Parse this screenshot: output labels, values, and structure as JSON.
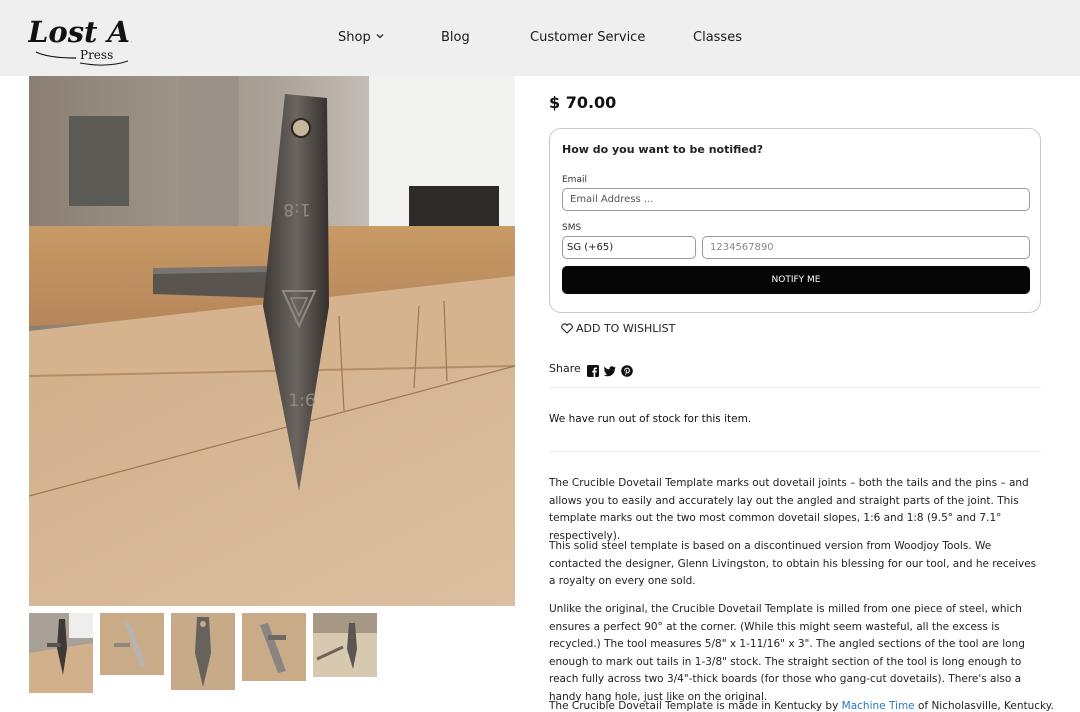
{
  "header": {
    "logo": {
      "line1": "Lost Art",
      "line2": "Press"
    },
    "nav": [
      {
        "label": "Shop",
        "has_dropdown": true
      },
      {
        "label": "Blog",
        "has_dropdown": false
      },
      {
        "label": "Customer Service",
        "has_dropdown": false
      },
      {
        "label": "Classes",
        "has_dropdown": false
      }
    ],
    "background": "#efefef"
  },
  "product": {
    "price": "$ 70.00",
    "main_image": {
      "markings": [
        "1:8",
        "1:6"
      ]
    },
    "thumbnail_count": 5
  },
  "notify": {
    "title": "How do you want to be notified?",
    "email_label": "Email",
    "email_placeholder": "Email Address ...",
    "sms_label": "SMS",
    "sms_country": "SG (+65)",
    "phone_placeholder": "1234567890",
    "button_label": "NOTIFY ME",
    "button_color": "#060606"
  },
  "wishlist": {
    "label": "ADD TO WISHLIST",
    "icon": "heart-icon"
  },
  "share": {
    "label": "Share",
    "icons": [
      "facebook-icon",
      "twitter-icon",
      "pinterest-icon"
    ]
  },
  "stock_message": "We have run out of stock for this item.",
  "description": {
    "p1": "The Crucible Dovetail Template marks out dovetail joints – both the tails and the pins – and allows you to easily and accurately lay out the angled and straight parts of the joint. This template marks out the two most common dovetail slopes, 1:6 and 1:8 (9.5° and 7.1° respectively).",
    "p2": "This solid steel template is based on a discontinued version from Woodjoy Tools. We contacted the designer, Glenn Livingston, to obtain his blessing for our tool, and he receives a royalty on every one sold.",
    "p3": "Unlike the original, the Crucible Dovetail Template is milled from one piece of steel, which ensures a perfect 90° at the corner. (While this might seem wasteful, all the excess is recycled.) The tool measures 5/8\" x 1-11/16\" x 3\". The angled sections of the tool are long enough to mark out tails in 1-3/8\" stock. The straight section of the tool is long enough to reach fully across two 3/4\"-thick boards (for those who gang-cut dovetails). There's also a handy hang hole, just like on the original.",
    "p4_before": "The Crucible Dovetail Template is made in Kentucky by ",
    "p4_link": "Machine Time",
    "p4_after": " of Nicholasville, Kentucky.",
    "link_color": "#2a78c4"
  }
}
